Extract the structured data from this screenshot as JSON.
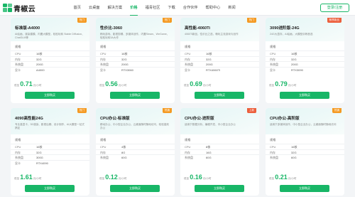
{
  "brand": {
    "name": "青椒云",
    "accent": "#18b667"
  },
  "nav": [
    {
      "label": "首页"
    },
    {
      "label": "云桌面"
    },
    {
      "label": "解决方案"
    },
    {
      "label": "价格"
    },
    {
      "label": "福青社区"
    },
    {
      "label": "下载"
    },
    {
      "label": "合作伙伴"
    },
    {
      "label": "帮助中心"
    },
    {
      "label": "新闻"
    }
  ],
  "header": {
    "login_label": "登录/注册"
  },
  "spec_heading": "规格",
  "price_prefix": "低至",
  "buy_label": "立即购买",
  "cards": [
    {
      "tag": "热门",
      "tag_color": "orange",
      "title": "标准版-A4000",
      "desc": "AI绘画、渲染建模、内置大模型，轻松玩转 Stable Diffusion、ChatGLM等",
      "specs": [
        [
          "CPU",
          "16核"
        ],
        [
          "内存",
          "32G"
        ],
        [
          "系统盘",
          "200G"
        ],
        [
          "显卡",
          "A4000"
        ]
      ],
      "price_int": "0.71",
      "price_unit": "元/小时"
    },
    {
      "tag": "热门",
      "tag_color": "orange",
      "title": "性价比-3060",
      "desc": "畅玩游戏、影视剪辑、多媒体创作，内置Steam、WeGame，轻松玩转3A大作",
      "specs": [
        [
          "CPU",
          "16核"
        ],
        [
          "内存",
          "32G"
        ],
        [
          "系统盘",
          "200G"
        ],
        [
          "显卡",
          "RTX3060"
        ]
      ],
      "price_int": "0.56",
      "price_unit": "元/小时"
    },
    {
      "tag": "热门",
      "tag_color": "orange",
      "title": "高性能-4060Ti",
      "desc": "4060Ti新品，性价比之选，畅玩主流游戏与创作",
      "specs": [
        [
          "CPU",
          "16核"
        ],
        [
          "内存",
          "32G"
        ],
        [
          "系统盘",
          "200G"
        ],
        [
          "显卡",
          "RTX4060Ti"
        ]
      ],
      "price_int": "0.69",
      "price_unit": "元/小时"
    },
    {
      "tag": "畅享新品",
      "tag_color": "red",
      "title": "3090进阶版-24G",
      "desc": "24G大显存，AI绘画、大模型训练首选",
      "specs": [
        [
          "CPU",
          "16核"
        ],
        [
          "内存",
          "32G"
        ],
        [
          "系统盘",
          "200G"
        ],
        [
          "显卡",
          "RTX3090"
        ]
      ],
      "price_int": "0.79",
      "price_unit": "元/小时"
    },
    {
      "tag": "热门",
      "tag_color": "orange",
      "title": "4090高性能24G",
      "desc": "专业高显卡，3D渲染、影视后期、设计制作、AI大模型一站式搞定",
      "specs": [
        [
          "CPU",
          "16核"
        ],
        [
          "内存",
          "32G"
        ],
        [
          "系统盘",
          "300G"
        ],
        [
          "显卡",
          "RTX4090"
        ]
      ],
      "price_int": "1.61",
      "price_unit": "元/小时"
    },
    {
      "tag": "热销",
      "tag_color": "orange",
      "title": "CPU办公-标准版",
      "desc": "移动办公、中小型企业办公，云桌面随时随地访问，轻松高效办公",
      "specs": [
        [
          "CPU",
          "4核"
        ],
        [
          "内存",
          "8G"
        ],
        [
          "系统盘",
          "60G"
        ]
      ],
      "price_int": "0.12",
      "price_unit": "元/小时"
    },
    {
      "tag": "上新",
      "tag_color": "red",
      "title": "CPU办公-进阶版",
      "desc": "适用于数据分析、编程开发、中小型企业办公",
      "specs": [
        [
          "CPU",
          "8核"
        ],
        [
          "内存",
          "16G"
        ],
        [
          "系统盘",
          "60G"
        ]
      ],
      "price_int": "0.16",
      "price_unit": "元/小时"
    },
    {
      "tag": "热销",
      "tag_color": "orange",
      "title": "CPU办公-高阶版",
      "desc": "适用于多媒体创作、中小型企业办公，云桌面随时随地访问",
      "specs": [
        [
          "CPU",
          "16核"
        ],
        [
          "内存",
          "32G"
        ],
        [
          "系统盘",
          "60G"
        ]
      ],
      "price_int": "0.21",
      "price_unit": "元/小时"
    }
  ]
}
